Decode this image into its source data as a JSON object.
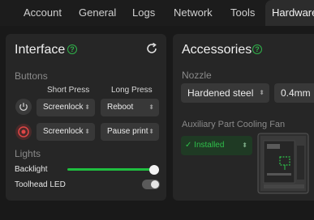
{
  "tabs": [
    "Account",
    "General",
    "Logs",
    "Network",
    "Tools",
    "Hardware"
  ],
  "interface": {
    "title": "Interface",
    "buttons_heading": "Buttons",
    "col_short": "Short Press",
    "col_long": "Long Press",
    "rows": [
      {
        "short": "Screenlock",
        "long": "Reboot"
      },
      {
        "short": "Screenlock",
        "long": "Pause print"
      }
    ],
    "lights_heading": "Lights",
    "backlight_label": "Backlight",
    "backlight_level": 1.0,
    "toolhead_led_label": "Toolhead LED",
    "toolhead_led_on": false
  },
  "accessories": {
    "title": "Accessories",
    "nozzle_heading": "Nozzle",
    "nozzle_material": "Hardened steel",
    "nozzle_size": "0.4mm",
    "fan_heading": "Auxiliary Part Cooling Fan",
    "fan_status": "Installed"
  },
  "colors": {
    "accent": "#2fb24a",
    "background": "#191919",
    "panel": "#262626",
    "dropdown": "#383838"
  },
  "icons": [
    "help-icon",
    "refresh-icon",
    "power-icon",
    "stop-icon",
    "chevron-up-down-icon",
    "check-icon"
  ]
}
